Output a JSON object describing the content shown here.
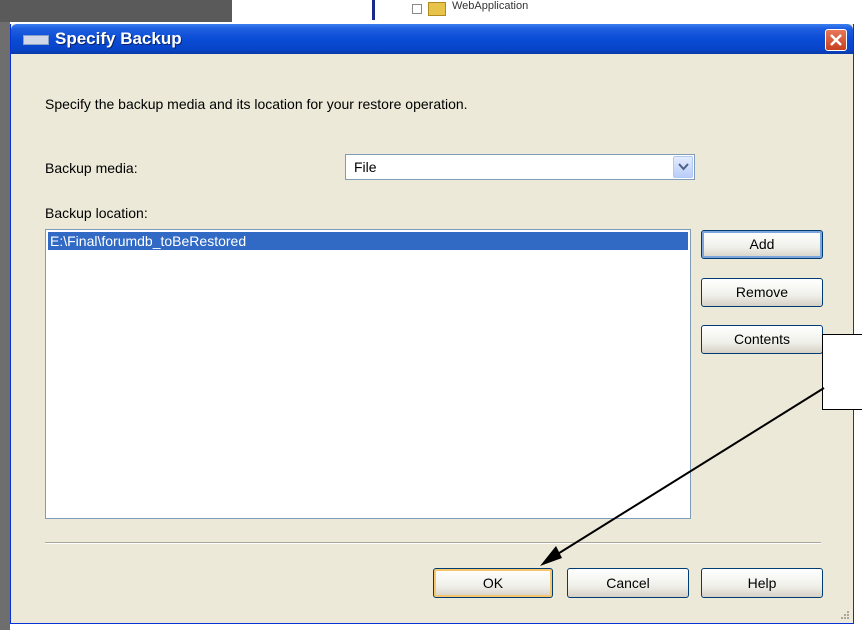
{
  "background": {
    "tree_label": "WebApplication"
  },
  "dialog": {
    "title": "Specify Backup",
    "instruction": "Specify the backup media and its location for your restore operation.",
    "backup_media_label": "Backup media:",
    "backup_media_value": "File",
    "backup_location_label": "Backup location:",
    "locations": [
      "E:\\Final\\forumdb_toBeRestored"
    ],
    "buttons": {
      "add": "Add",
      "remove": "Remove",
      "contents": "Contents",
      "ok": "OK",
      "cancel": "Cancel",
      "help": "Help"
    }
  },
  "colors": {
    "titlebar": "#0a4cd6",
    "selection": "#316ac5",
    "dialog_bg": "#ece9d8"
  },
  "icons": [
    "window-icon",
    "close-icon",
    "dropdown-arrow-icon",
    "resize-grip-icon"
  ]
}
